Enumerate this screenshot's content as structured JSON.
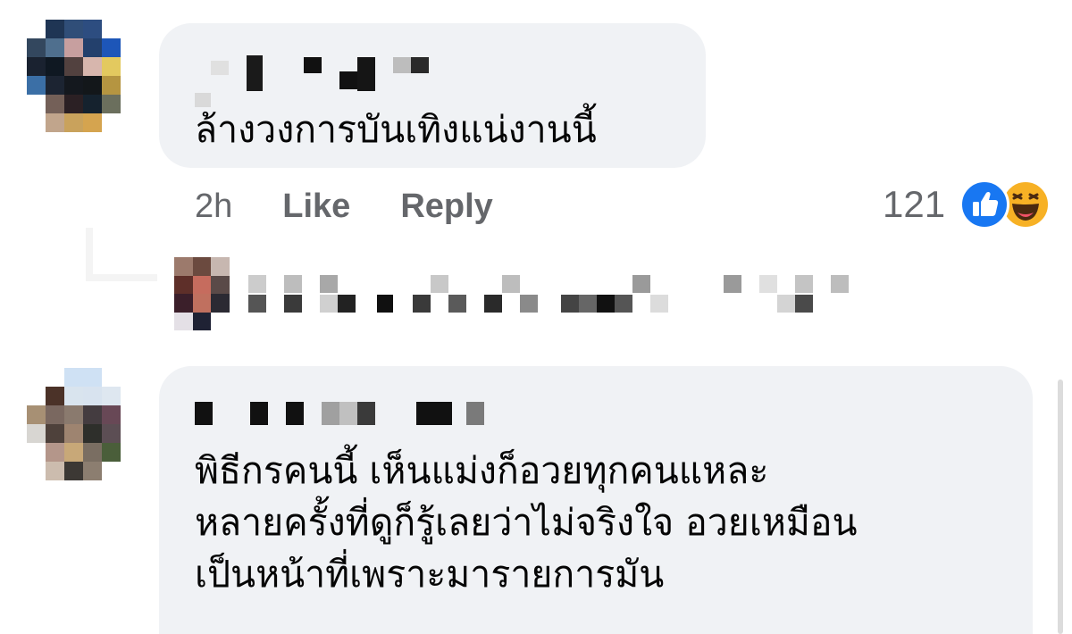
{
  "comments": [
    {
      "text": "ล้างวงการบันเทิงแน่งานนี้",
      "time": "2h",
      "like_label": "Like",
      "reply_label": "Reply",
      "reaction_count": "121",
      "reactions": [
        "like-icon",
        "haha-icon"
      ]
    },
    {
      "text_lines": [
        "พิธีกรคนนี้ เห็นแม่งก็อวยทุกคนแหละ",
        "หลายครั้งที่ดูก็รู้เลยว่าไม่จริงใจ อวยเหมือน",
        "เป็นหน้าที่เพราะมารายการมัน"
      ]
    }
  ],
  "colors": {
    "bubble": "#f0f2f5",
    "text": "#050505",
    "secondary": "#65676b",
    "like_blue": "#1877f2",
    "haha_yellow": "#f7b125"
  },
  "icons": {
    "like": "like-icon",
    "haha": "haha-icon"
  }
}
